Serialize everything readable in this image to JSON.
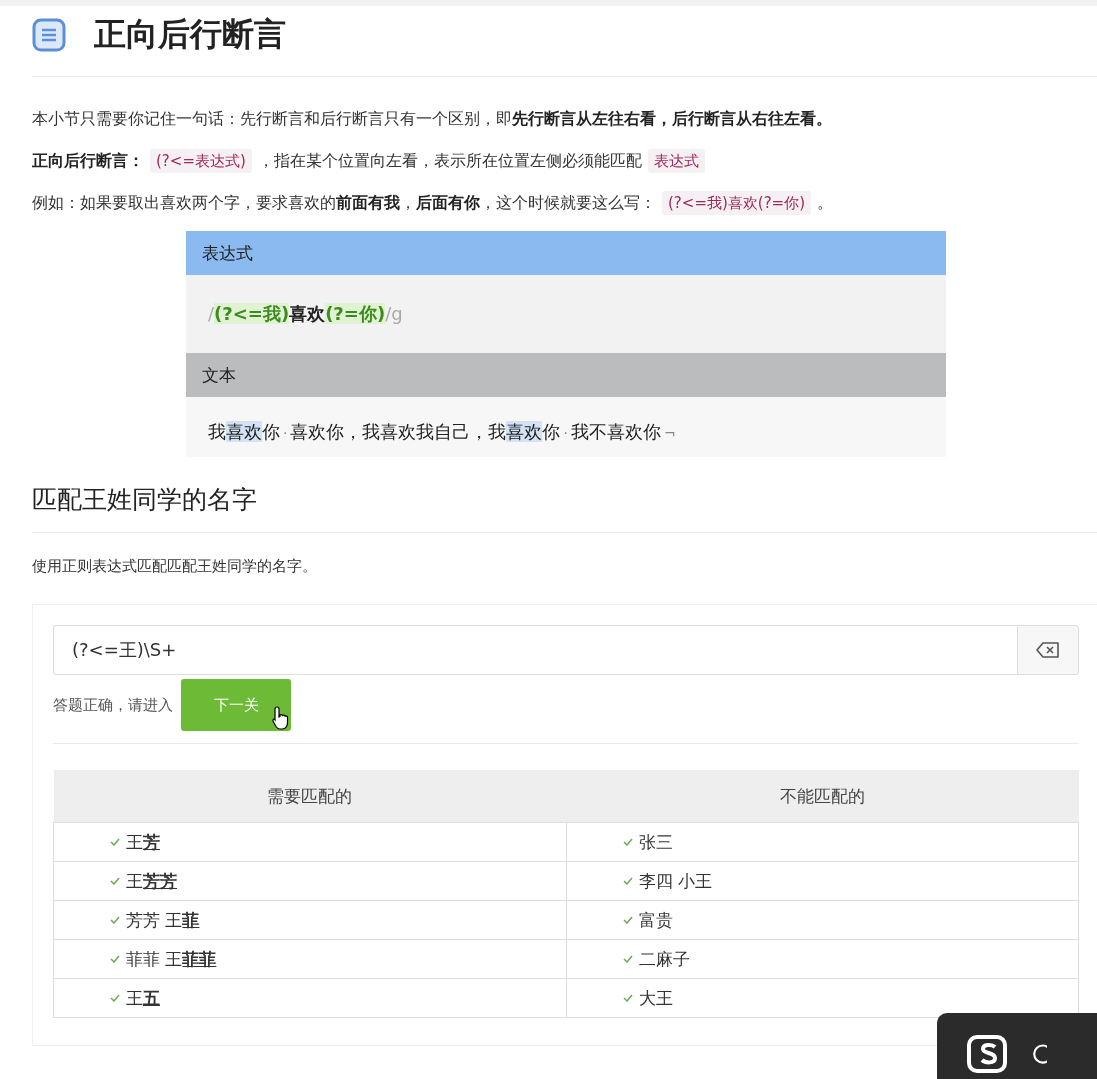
{
  "title": "正向后行断言",
  "paragraphs": [
    [
      {
        "kind": "text",
        "t": "本小节只需要你记住一句话：先行断言和后行断言只有一个区别，即"
      },
      {
        "kind": "bold",
        "t": "先行断言从左往右看，后行断言从右往左看。"
      }
    ],
    [
      {
        "kind": "bold",
        "t": "正向后行断言："
      },
      {
        "kind": "code",
        "t": "(?<=表达式)"
      },
      {
        "kind": "text",
        "t": "，指在某个位置向左看，表示所在位置左侧必须能匹配"
      },
      {
        "kind": "code",
        "t": "表达式"
      }
    ],
    [
      {
        "kind": "text",
        "t": "例如：如果要取出喜欢两个字，要求喜欢的"
      },
      {
        "kind": "bold",
        "t": "前面有我"
      },
      {
        "kind": "text",
        "t": "，"
      },
      {
        "kind": "bold",
        "t": "后面有你"
      },
      {
        "kind": "text",
        "t": "，这个时候就要这么写："
      },
      {
        "kind": "code",
        "t": "(?<=我)喜欢(?=你)"
      },
      {
        "kind": "text",
        "t": "。"
      }
    ]
  ],
  "demo": {
    "expression_label": "表达式",
    "expression": [
      {
        "kind": "delim",
        "t": "/"
      },
      {
        "kind": "group",
        "t": "(?<=我)"
      },
      {
        "kind": "bold",
        "t": "喜欢"
      },
      {
        "kind": "group",
        "t": "(?=你)"
      },
      {
        "kind": "delim",
        "t": "/g"
      }
    ],
    "text_label": "文本",
    "text": [
      {
        "kind": "text",
        "t": "我"
      },
      {
        "kind": "hl",
        "t": "喜欢"
      },
      {
        "kind": "text",
        "t": "你"
      },
      {
        "kind": "ws",
        "t": "·"
      },
      {
        "kind": "text",
        "t": "喜欢你，我喜欢我自己，我"
      },
      {
        "kind": "hl",
        "t": "喜欢"
      },
      {
        "kind": "text",
        "t": "你"
      },
      {
        "kind": "ws",
        "t": "·"
      },
      {
        "kind": "text",
        "t": "我不喜欢你"
      },
      {
        "kind": "ws",
        "t": "¬"
      }
    ]
  },
  "section_title": "匹配王姓同学的名字",
  "section_desc": "使用正则表达式匹配匹配王姓同学的名字。",
  "quiz": {
    "input": {
      "value": "(?<=王)\\S+"
    },
    "result": "答题正确，请进入",
    "next_button": "下一关",
    "columns": [
      "需要匹配的",
      "不能匹配的"
    ],
    "rows": [
      {
        "match": {
          "text": "王**芳**",
          "passed": true
        },
        "no_match": {
          "text": "张三",
          "passed": true
        }
      },
      {
        "match": {
          "text": "王**芳芳**",
          "passed": true
        },
        "no_match": {
          "text": "李四 小王",
          "passed": true
        }
      },
      {
        "match": {
          "text": "芳芳 王**菲**",
          "passed": true
        },
        "no_match": {
          "text": "富贵",
          "passed": true
        }
      },
      {
        "match": {
          "text": "菲菲 王**菲菲**",
          "passed": true
        },
        "no_match": {
          "text": "二麻子",
          "passed": true
        }
      },
      {
        "match": {
          "text": "王**五**",
          "passed": true
        },
        "no_match": {
          "text": "大王",
          "passed": true
        }
      }
    ]
  }
}
